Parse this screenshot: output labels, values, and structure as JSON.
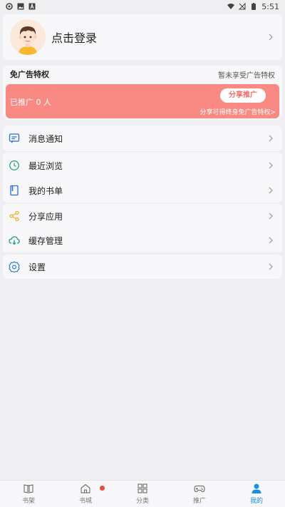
{
  "status_bar": {
    "time": "5:51"
  },
  "profile": {
    "login_label": "点击登录"
  },
  "ad_free": {
    "title": "免广告特权",
    "status": "暂未享受广告特权",
    "promoted_count": "已推广 0 人",
    "share_button": "分享推广",
    "hint": "分享可得终身免广告特权>"
  },
  "menu": {
    "group1": [
      {
        "label": "消息通知",
        "icon": "message-icon"
      },
      {
        "label": "最近浏览",
        "icon": "clock-icon"
      },
      {
        "label": "我的书单",
        "icon": "book-icon"
      }
    ],
    "group2": [
      {
        "label": "分享应用",
        "icon": "share-icon"
      },
      {
        "label": "缓存管理",
        "icon": "cloud-download-icon"
      }
    ],
    "group3": [
      {
        "label": "设置",
        "icon": "gear-icon"
      }
    ]
  },
  "tabs": [
    {
      "label": "书架",
      "icon": "bookshelf-icon",
      "active": false
    },
    {
      "label": "书城",
      "icon": "home-icon",
      "active": false,
      "badge": true
    },
    {
      "label": "分类",
      "icon": "grid-icon",
      "active": false
    },
    {
      "label": "推广",
      "icon": "gamepad-icon",
      "active": false
    },
    {
      "label": "我的",
      "icon": "user-icon",
      "active": true
    }
  ],
  "colors": {
    "accent": "#1a8fe0",
    "promo_bg": "#f98a83",
    "share_text": "#f06b62",
    "badge": "#e74c3c"
  }
}
